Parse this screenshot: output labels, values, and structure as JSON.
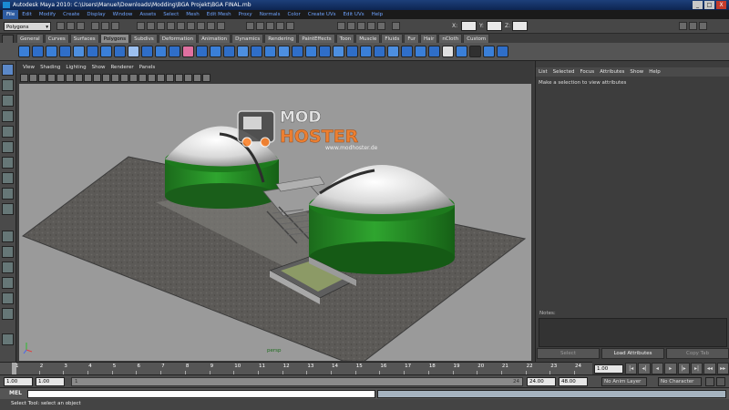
{
  "window": {
    "title": "Autodesk Maya 2010: C:\\Users\\Manuel\\Downloads\\Modding\\BGA Projekt\\BGA FINAL.mb",
    "controls": [
      "_",
      "□",
      "X"
    ]
  },
  "menubar": {
    "items": [
      "File",
      "Edit",
      "Modify",
      "Create",
      "Display",
      "Window",
      "Assets",
      "Select",
      "Mesh",
      "Edit Mesh",
      "Proxy",
      "Normals",
      "Color",
      "Create UVs",
      "Edit UVs",
      "Help"
    ]
  },
  "statusline": {
    "mode": "Polygons",
    "mode_arrow": "▾"
  },
  "shelf": {
    "tabs": [
      "General",
      "Curves",
      "Surfaces",
      "Polygons",
      "Subdivs",
      "Deformation",
      "Animation",
      "Dynamics",
      "Rendering",
      "PaintEffects",
      "Toon",
      "Muscle",
      "Fluids",
      "Fur",
      "Hair",
      "nCloth",
      "Custom"
    ],
    "active_tab": "Polygons",
    "icon_colors": [
      "#3a7fd8",
      "#2f6ec8",
      "#3a7fd8",
      "#2f6ec8",
      "#4d8fe0",
      "#2f6ec8",
      "#3a7fd8",
      "#2f6ec8",
      "#9cc0f0",
      "#2f6ec8",
      "#3a7fd8",
      "#2f6ec8",
      "#e070a0",
      "#2f6ec8",
      "#3a7fd8",
      "#2f6ec8",
      "#4d8fe0",
      "#2f6ec8",
      "#3a7fd8",
      "#4d8fe0",
      "#2f6ec8",
      "#3a7fd8",
      "#2f6ec8",
      "#4d8fe0",
      "#2f6ec8",
      "#3a7fd8",
      "#2f6ec8",
      "#4d8fe0",
      "#2f6ec8",
      "#3a7fd8",
      "#2f6ec8",
      "#e0e0e0",
      "#3a7fd8",
      "#303030",
      "#3a7fd8",
      "#2f6ec8"
    ]
  },
  "panel": {
    "menu": [
      "View",
      "Shading",
      "Lighting",
      "Show",
      "Renderer",
      "Panels"
    ],
    "camera_label": "persp"
  },
  "watermark": {
    "line1": "MOD",
    "line2": "HOSTER",
    "url": "www.modhoster.de"
  },
  "attribute_editor": {
    "menu": [
      "List",
      "Selected",
      "Focus",
      "Attributes",
      "Show",
      "Help"
    ],
    "message": "Make a selection to view attributes",
    "notes_label": "Notes:",
    "buttons": [
      "Select",
      "Load Attributes",
      "Copy Tab"
    ]
  },
  "timeline": {
    "ticks": [
      "1",
      "2",
      "3",
      "4",
      "5",
      "6",
      "7",
      "8",
      "9",
      "10",
      "11",
      "12",
      "13",
      "14",
      "15",
      "16",
      "17",
      "18",
      "19",
      "20",
      "21",
      "22",
      "23",
      "24"
    ],
    "current_frame": "1.00",
    "playback": [
      "|◂",
      "◂|",
      "◂",
      "▸",
      "|▸",
      "▸|",
      "◂◂",
      "▸▸"
    ]
  },
  "range": {
    "start": "1.00",
    "playback_start": "1.00",
    "range_start": "1",
    "range_end": "24",
    "playback_end": "24.00",
    "end": "48.00",
    "anim_layer": "No Anim Layer",
    "character_set": "No Character Set"
  },
  "command_line": {
    "label": "MEL",
    "value": ""
  },
  "help_line": {
    "text": "Select Tool: select an object"
  }
}
